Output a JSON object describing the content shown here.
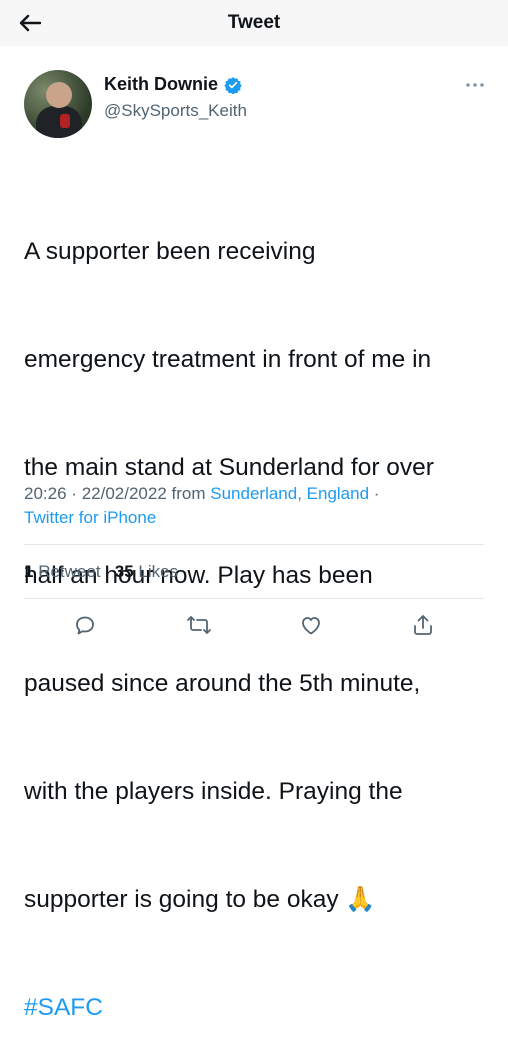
{
  "header": {
    "title": "Tweet",
    "back_icon": "arrow-left-icon"
  },
  "tweet": {
    "author": {
      "name": "Keith Downie",
      "handle": "@SkySports_Keith",
      "verified": true,
      "verified_icon": "verified-badge-icon"
    },
    "more_icon": "more-horizontal-icon",
    "text_lines": [
      "A supporter been receiving",
      "emergency treatment in front of me in",
      "the main stand at Sunderland for over",
      "half an hour now. Play has been",
      "paused since around the 5th minute,",
      "with the players inside. Praying the",
      "supporter is going to be okay 🙏"
    ],
    "hashtag": "#SAFC",
    "time": "20:26",
    "date": "22/02/2022",
    "from_label": "from",
    "location": "Sunderland, England",
    "source": "Twitter for iPhone",
    "separator": "·"
  },
  "stats": {
    "retweets_count": "1",
    "retweets_label": "Retweet",
    "likes_count": "35",
    "likes_label": "Likes"
  },
  "actions": [
    {
      "name": "reply",
      "icon": "reply-icon"
    },
    {
      "name": "retweet",
      "icon": "retweet-icon"
    },
    {
      "name": "like",
      "icon": "heart-icon"
    },
    {
      "name": "share",
      "icon": "share-icon"
    }
  ],
  "colors": {
    "text": "#0f1419",
    "secondary": "#536471",
    "accent": "#1d9bf0"
  }
}
